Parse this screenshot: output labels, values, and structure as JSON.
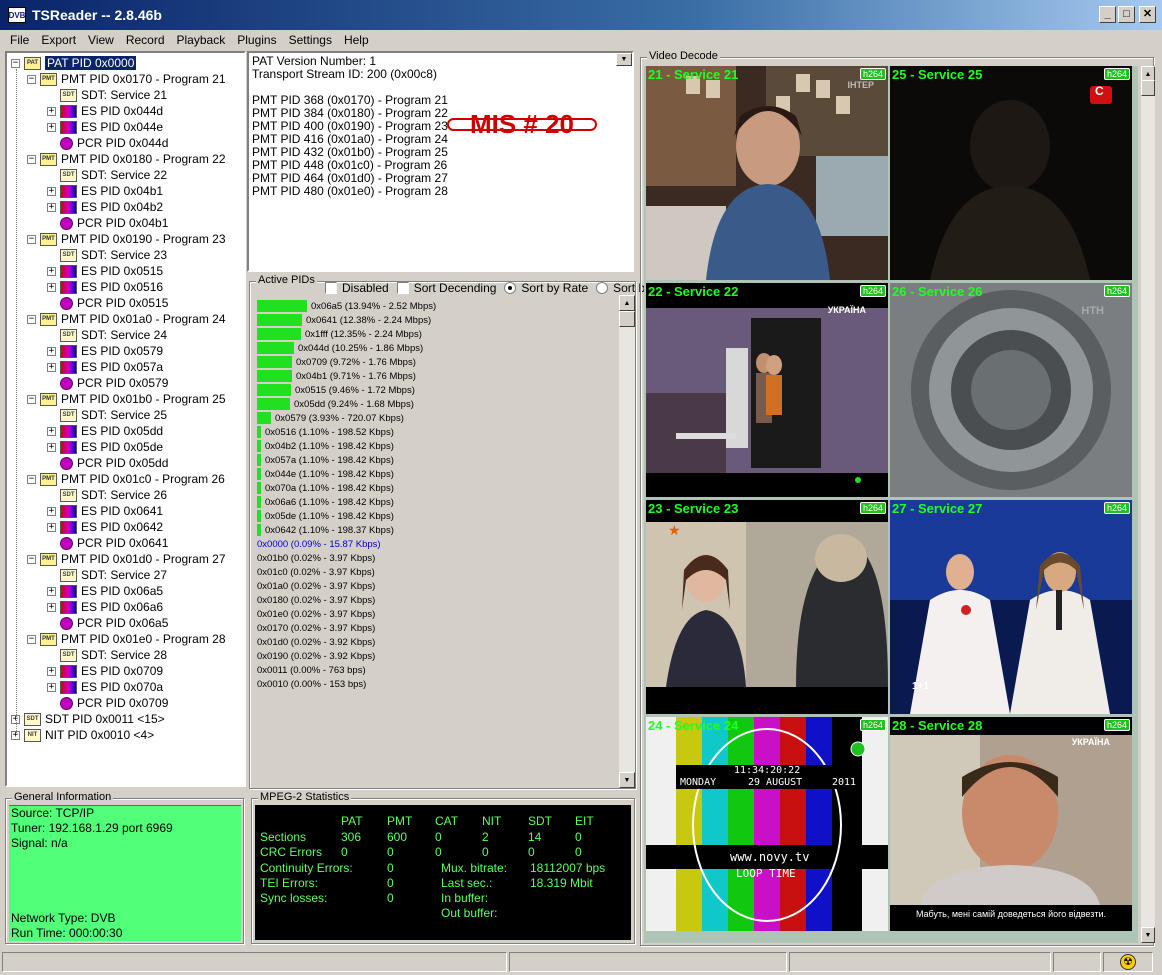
{
  "app": {
    "title": "TSReader -- 2.8.46b",
    "icon_text": "DVB"
  },
  "menu": [
    "File",
    "Export",
    "View",
    "Record",
    "Playback",
    "Plugins",
    "Settings",
    "Help"
  ],
  "tree": {
    "root": "PAT PID 0x0000",
    "programs": [
      {
        "pmt": "PMT PID 0x0170 - Program 21",
        "sdt": "SDT: Service 21",
        "es": [
          "ES PID 0x044d",
          "ES PID 0x044e"
        ],
        "pcr": "PCR PID 0x044d"
      },
      {
        "pmt": "PMT PID 0x0180 - Program 22",
        "sdt": "SDT: Service 22",
        "es": [
          "ES PID 0x04b1",
          "ES PID 0x04b2"
        ],
        "pcr": "PCR PID 0x04b1"
      },
      {
        "pmt": "PMT PID 0x0190 - Program 23",
        "sdt": "SDT: Service 23",
        "es": [
          "ES PID 0x0515",
          "ES PID 0x0516"
        ],
        "pcr": "PCR PID 0x0515"
      },
      {
        "pmt": "PMT PID 0x01a0 - Program 24",
        "sdt": "SDT: Service 24",
        "es": [
          "ES PID 0x0579",
          "ES PID 0x057a"
        ],
        "pcr": "PCR PID 0x0579"
      },
      {
        "pmt": "PMT PID 0x01b0 - Program 25",
        "sdt": "SDT: Service 25",
        "es": [
          "ES PID 0x05dd",
          "ES PID 0x05de"
        ],
        "pcr": "PCR PID 0x05dd"
      },
      {
        "pmt": "PMT PID 0x01c0 - Program 26",
        "sdt": "SDT: Service 26",
        "es": [
          "ES PID 0x0641",
          "ES PID 0x0642"
        ],
        "pcr": "PCR PID 0x0641"
      },
      {
        "pmt": "PMT PID 0x01d0 - Program 27",
        "sdt": "SDT: Service 27",
        "es": [
          "ES PID 0x06a5",
          "ES PID 0x06a6"
        ],
        "pcr": "PCR PID 0x06a5"
      },
      {
        "pmt": "PMT PID 0x01e0 - Program 28",
        "sdt": "SDT: Service 28",
        "es": [
          "ES PID 0x0709",
          "ES PID 0x070a"
        ],
        "pcr": "PCR PID 0x0709"
      }
    ],
    "sdt_root": "SDT PID 0x0011 <15>",
    "nit_root": "NIT PID 0x0010 <4>"
  },
  "pat_info": {
    "lines": [
      "PAT Version Number: 1",
      "Transport Stream ID: 200 (0x00c8)",
      "",
      "PMT PID 368 (0x0170) - Program 21",
      "PMT PID 384 (0x0180) - Program 22",
      "PMT PID 400 (0x0190) - Program 23",
      "PMT PID 416 (0x01a0) - Program 24",
      "PMT PID 432 (0x01b0) - Program 25",
      "PMT PID 448 (0x01c0) - Program 26",
      "PMT PID 464 (0x01d0) - Program 27",
      "PMT PID 480 (0x01e0) - Program 28"
    ],
    "overlay": "MIS # 20"
  },
  "active_pids": {
    "title": "Active PIDs",
    "options": {
      "disabled": "Disabled",
      "sort_desc": "Sort Decending",
      "sort_rate": "Sort by Rate",
      "sort_pid": "Sort by PID"
    },
    "rows": [
      {
        "text": "0x06a5 (13.94% - 2.52 Mbps)",
        "pct": 13.94
      },
      {
        "text": "0x0641 (12.38% - 2.24 Mbps)",
        "pct": 12.38
      },
      {
        "text": "0x1fff (12.35% - 2.24 Mbps)",
        "pct": 12.35
      },
      {
        "text": "0x044d (10.25% - 1.86 Mbps)",
        "pct": 10.25
      },
      {
        "text": "0x0709 (9.72% - 1.76 Mbps)",
        "pct": 9.72
      },
      {
        "text": "0x04b1 (9.71% - 1.76 Mbps)",
        "pct": 9.71
      },
      {
        "text": "0x0515 (9.46% - 1.72 Mbps)",
        "pct": 9.46
      },
      {
        "text": "0x05dd (9.24% - 1.68 Mbps)",
        "pct": 9.24
      },
      {
        "text": "0x0579 (3.93% - 720.07 Kbps)",
        "pct": 3.93
      },
      {
        "text": "0x0516 (1.10% - 198.52 Kbps)",
        "pct": 1.1
      },
      {
        "text": "0x04b2 (1.10% - 198.42 Kbps)",
        "pct": 1.1
      },
      {
        "text": "0x057a (1.10% - 198.42 Kbps)",
        "pct": 1.1
      },
      {
        "text": "0x044e (1.10% - 198.42 Kbps)",
        "pct": 1.1
      },
      {
        "text": "0x070a (1.10% - 198.42 Kbps)",
        "pct": 1.1
      },
      {
        "text": "0x06a6 (1.10% - 198.42 Kbps)",
        "pct": 1.1
      },
      {
        "text": "0x05de (1.10% - 198.42 Kbps)",
        "pct": 1.1
      },
      {
        "text": "0x0642 (1.10% - 198.37 Kbps)",
        "pct": 1.1
      },
      {
        "text": "0x0000 (0.09% - 15.87 Kbps)",
        "pct": 0.09,
        "color": "#0000cc"
      },
      {
        "text": "0x01b0 (0.02% - 3.97 Kbps)",
        "pct": 0.02
      },
      {
        "text": "0x01c0 (0.02% - 3.97 Kbps)",
        "pct": 0.02
      },
      {
        "text": "0x01a0 (0.02% - 3.97 Kbps)",
        "pct": 0.02
      },
      {
        "text": "0x0180 (0.02% - 3.97 Kbps)",
        "pct": 0.02
      },
      {
        "text": "0x01e0 (0.02% - 3.97 Kbps)",
        "pct": 0.02
      },
      {
        "text": "0x0170 (0.02% - 3.97 Kbps)",
        "pct": 0.02
      },
      {
        "text": "0x01d0 (0.02% - 3.92 Kbps)",
        "pct": 0.02
      },
      {
        "text": "0x0190 (0.02% - 3.92 Kbps)",
        "pct": 0.02
      },
      {
        "text": "0x0011 (0.00% - 763 bps)",
        "pct": 0.0
      },
      {
        "text": "0x0010 (0.00% - 153 bps)",
        "pct": 0.0
      }
    ]
  },
  "general_info": {
    "title": "General Information",
    "lines": [
      "Source: TCP/IP",
      "Tuner: 192.168.1.29 port 6969",
      "Signal: n/a",
      "",
      "",
      "",
      "",
      "Network Type: DVB",
      "Run Time: 000:00:30"
    ]
  },
  "mpeg_stats": {
    "title": "MPEG-2 Statistics",
    "headers": [
      "PAT",
      "PMT",
      "CAT",
      "NIT",
      "SDT",
      "EIT"
    ],
    "sections_label": "Sections",
    "sections": [
      "306",
      "600",
      "0",
      "2",
      "14",
      "0"
    ],
    "crc_label": "CRC Errors",
    "crc": [
      "0",
      "0",
      "0",
      "0",
      "0",
      "0"
    ],
    "continuity_label": "Continuity Errors:",
    "continuity": "0",
    "tei_label": "TEI Errors:",
    "tei": "0",
    "sync_label": "Sync losses:",
    "sync": "0",
    "mux_label": "Mux. bitrate:",
    "mux": "18112007 bps",
    "last_label": "Last sec.:",
    "last": "18.319 Mbit",
    "inbuf_label": "In buffer:",
    "outbuf_label": "Out buffer:"
  },
  "video": {
    "title": "Video Decode",
    "cells": [
      {
        "label": "21 - Service 21",
        "badge": "h264",
        "logo": "ІНТЕР"
      },
      {
        "label": "25 - Service 25",
        "badge": "h264",
        "logo": "С"
      },
      {
        "label": "22 - Service 22",
        "badge": "h264",
        "logo": "УКРАЇНА"
      },
      {
        "label": "26 - Service 26",
        "badge": "h264",
        "logo": "НТН"
      },
      {
        "label": "23 - Service 23",
        "badge": "h264",
        "logo": ""
      },
      {
        "label": "27 - Service 27",
        "badge": "h264",
        "logo": "1+1"
      },
      {
        "label": "24 - Service 24",
        "badge": "h264",
        "clock": "11:34:20:22",
        "day": "MONDAY",
        "date": "29 AUGUST",
        "year": "2011",
        "url": "www.novy.tv",
        "loop": "LOOP TIME"
      },
      {
        "label": "28 - Service 28",
        "badge": "h264",
        "logo": "УКРАЇНА",
        "subtitle": "Мабуть, мені самій доведеться його відвезти."
      }
    ]
  }
}
